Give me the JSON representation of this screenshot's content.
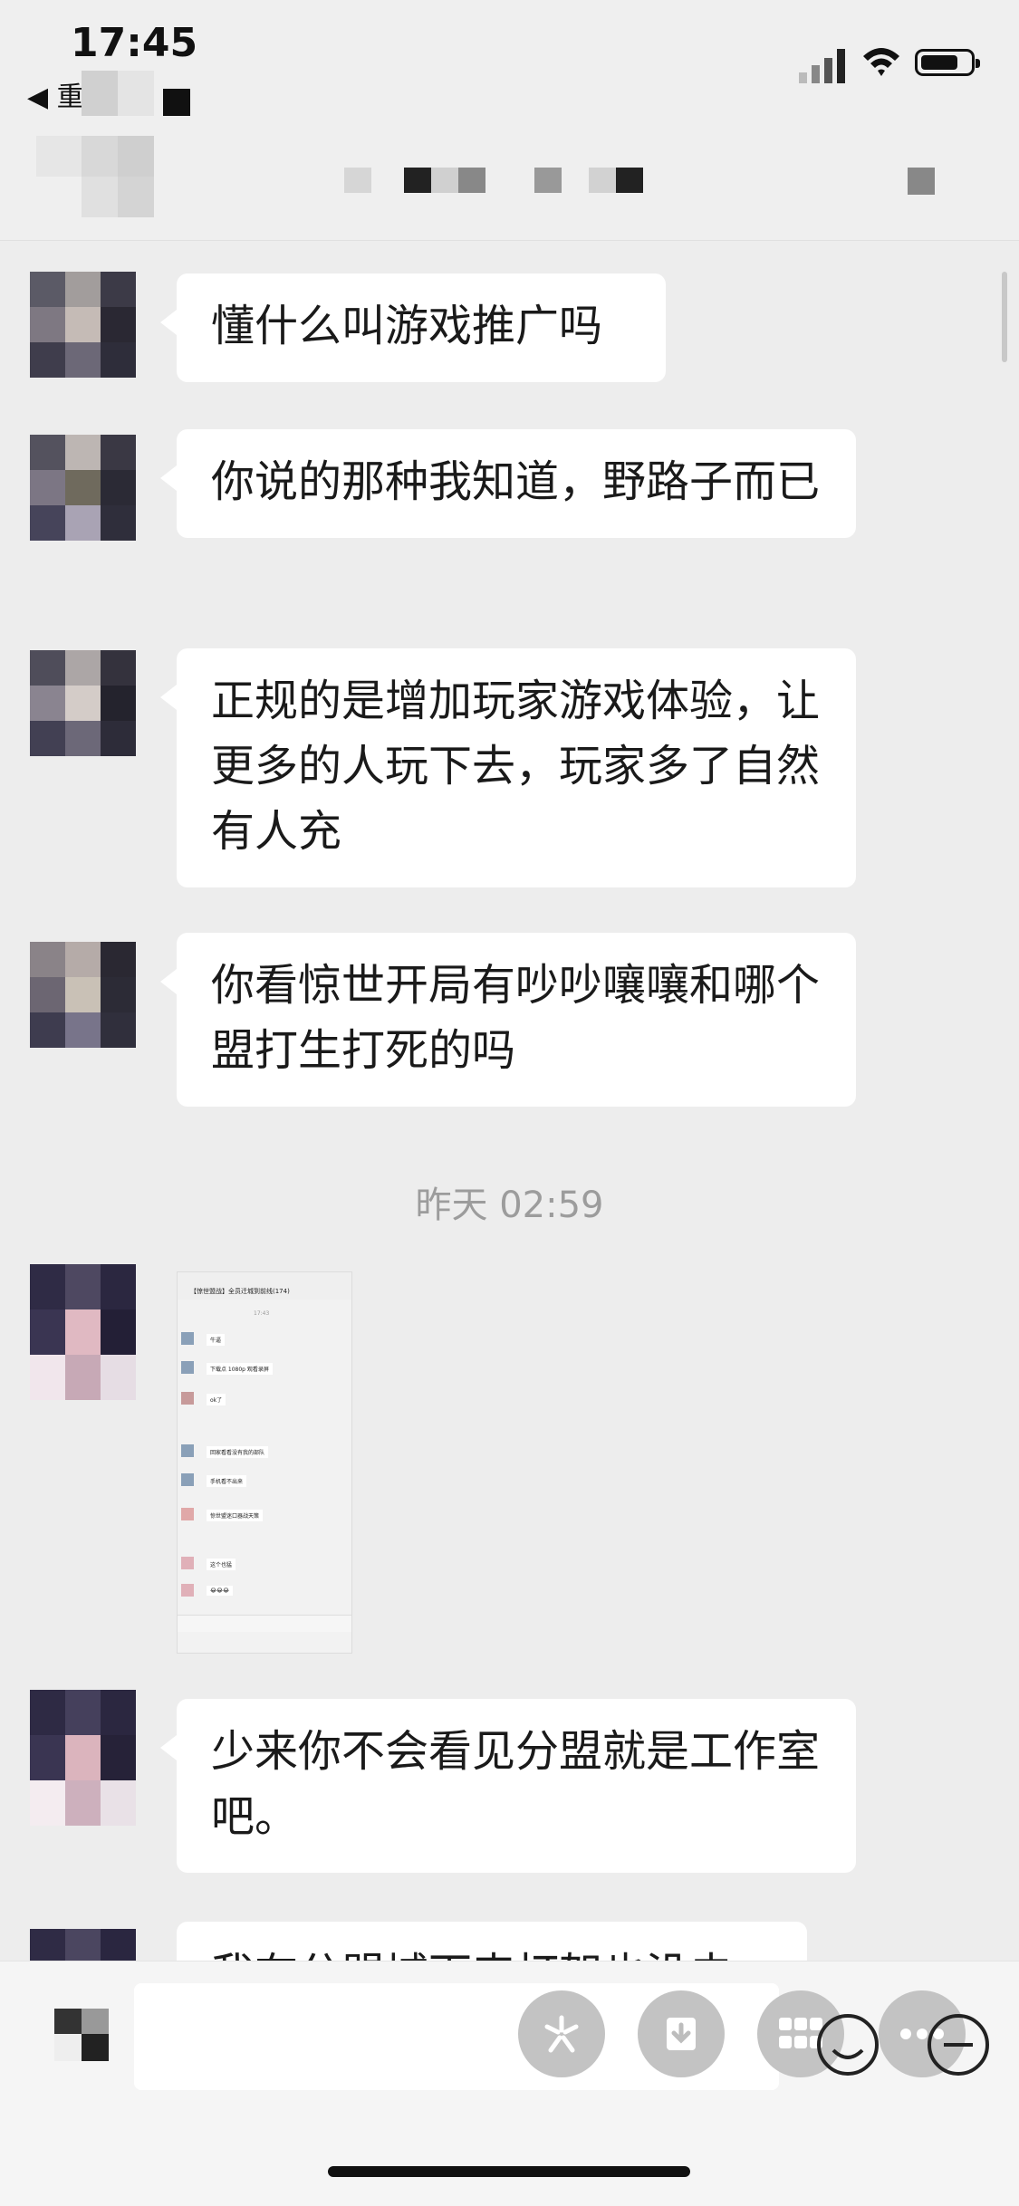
{
  "status_bar": {
    "time": "17:45",
    "back_app": "◀ 重"
  },
  "messages": [
    {
      "text": "懂什么叫游戏推广吗"
    },
    {
      "text": "你说的那种我知道，野路子而已"
    },
    {
      "text": "正规的是增加玩家游戏体验，让更多的人玩下去，玩家多了自然有人充"
    },
    {
      "text": "你看惊世开局有吵吵嚷嚷和哪个盟打生打死的吗"
    },
    {
      "text": "少来你不会看见分盟就是工作室吧。"
    },
    {
      "text": "我在分盟城下来打架也没去"
    }
  ],
  "timestamp": "昨天 02:59",
  "screenshot_thumb": {
    "title": "【惊世盟战】全员迁城到前线(174)",
    "time": "17:43",
    "items": [
      "牛逼",
      "下载点 1080p 观看录屏",
      "ok了",
      "回家看看没有我的部队",
      "手机看不出来",
      "惊世盟迷口器战天策",
      "这个也猛",
      "😂😂😂"
    ]
  },
  "input_bar": {
    "fab_icons": [
      "star-burst-icon",
      "download-icon",
      "grid-icon",
      "more-icon"
    ]
  }
}
